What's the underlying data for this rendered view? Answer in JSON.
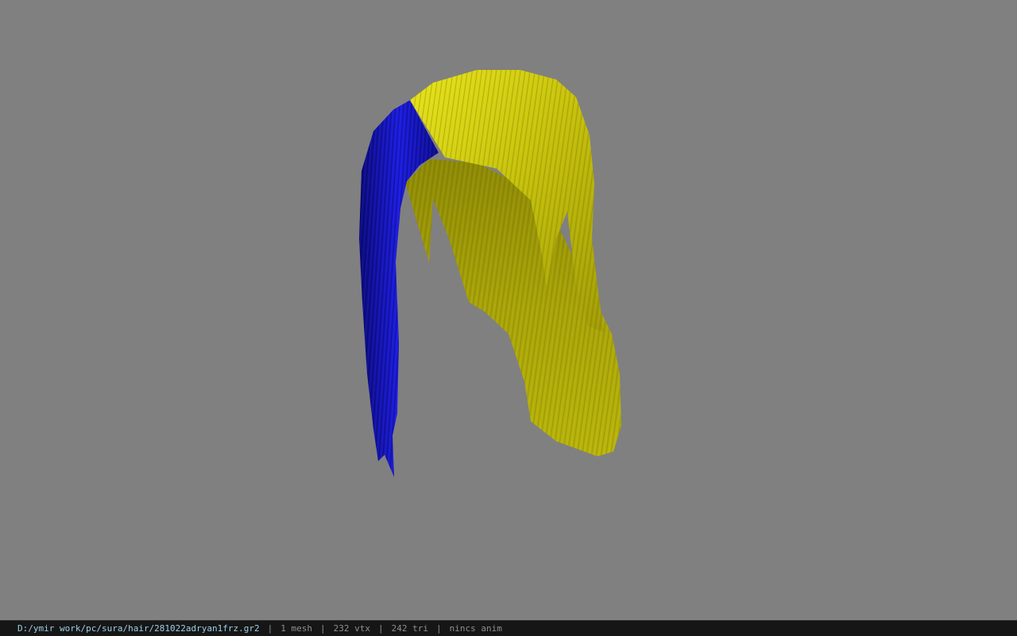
{
  "viewer": {
    "background_color": "#808080",
    "model_colors": {
      "hair_main": "#c9c40a",
      "hair_highlight": "#e6e21a",
      "hair_shadow": "#8e8a05",
      "strand_accent": "#1a1ad8",
      "strand_shadow": "#08086a"
    }
  },
  "status_bar": {
    "file_path": "D:/ymir work/pc/sura/hair/281022adryan1frz.gr2",
    "separator": "|",
    "mesh_count": "1 mesh",
    "vertex_count": "232 vtx",
    "triangle_count": "242 tri",
    "anim_status": "nincs anim"
  }
}
